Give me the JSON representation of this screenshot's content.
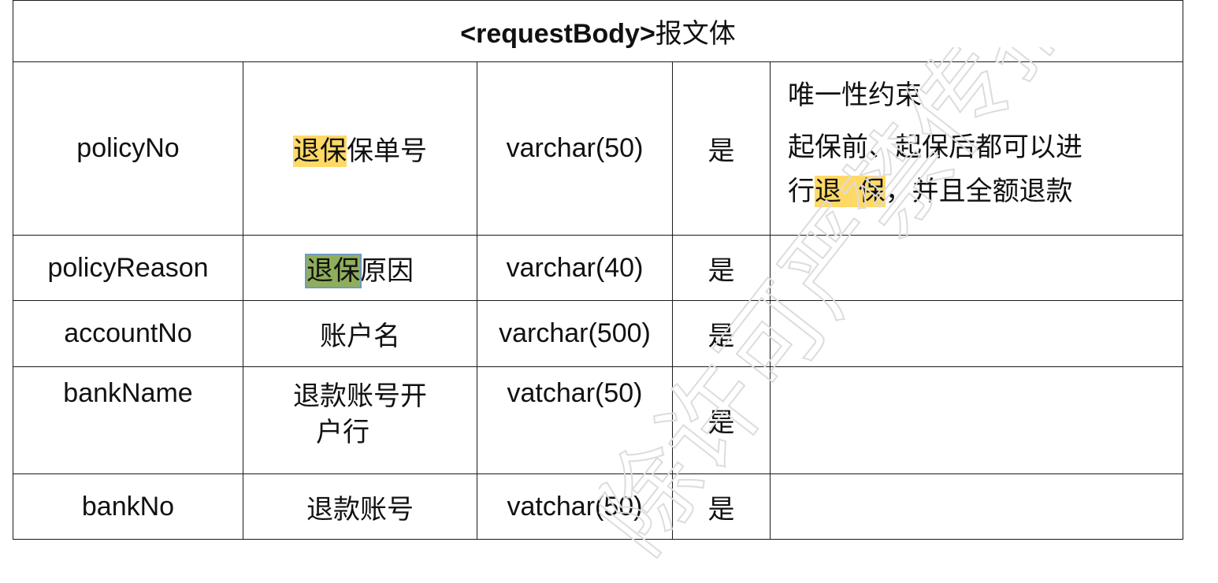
{
  "title_bold": "<requestBody>",
  "title_rest": "报文体",
  "rows": [
    {
      "field": "policyNo",
      "name_highlight": "退保",
      "name_rest": "保单号",
      "type": "varchar(50)",
      "required": "是",
      "note_line1": "唯一性约束",
      "note_line2": "起保前、起保后都可以进",
      "note_line3_pre": "行",
      "note_line3_hl": "退  保",
      "note_line3_post": "，并且全额退款"
    },
    {
      "field": "policyReason",
      "name_highlight": "退保",
      "name_rest": "原因",
      "type": "varchar(40)",
      "required": "是"
    },
    {
      "field": "accountNo",
      "name": "账户名",
      "type": "varchar(500)",
      "required": "是"
    },
    {
      "field": "bankName",
      "name_line1": "退款账号开",
      "name_line2": "户行",
      "type": "vatchar(50)",
      "required": "是"
    },
    {
      "field": "bankNo",
      "name": "退款账号",
      "type": "vatchar(50)",
      "required": "是"
    }
  ],
  "watermark": "除许可严禁传播",
  "colors": {
    "highlight_yellow": "#ffd966",
    "highlight_green": "#8fae5b",
    "border": "#1a1a1a"
  }
}
